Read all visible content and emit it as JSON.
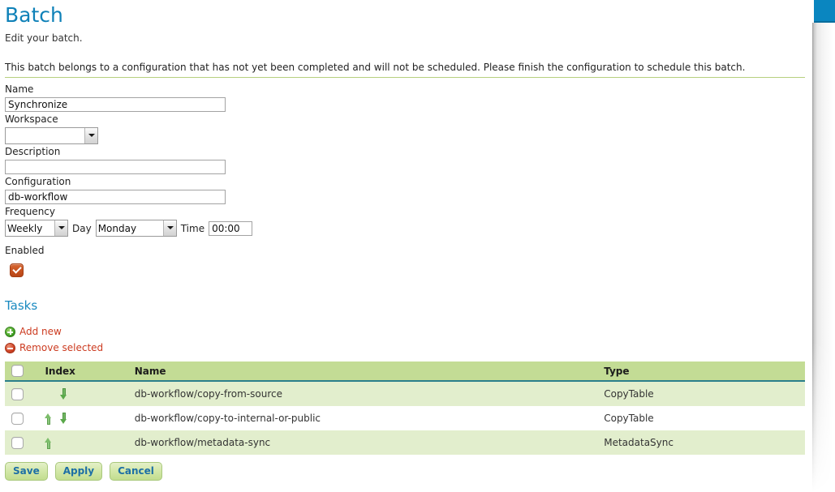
{
  "page": {
    "title": "Batch",
    "subtitle": "Edit your batch.",
    "feedback_message": "This batch belongs to a configuration that has not yet been completed and will not be scheduled. Please finish the configuration to schedule this batch.",
    "accent_color": "#0f81b8",
    "link_color": "#cc3b20",
    "table_header_color": "#c3dc95"
  },
  "form": {
    "name": {
      "label": "Name",
      "value": "Synchronize",
      "placeholder": ""
    },
    "workspace": {
      "label": "Workspace",
      "value": "",
      "options": [
        ""
      ]
    },
    "description": {
      "label": "Description",
      "value": "",
      "placeholder": ""
    },
    "configuration": {
      "label": "Configuration",
      "value": "db-workflow",
      "placeholder": ""
    },
    "frequency": {
      "label": "Frequency",
      "value": "Weekly",
      "options": [
        "Weekly"
      ],
      "day_label": "Day",
      "day_value": "Monday",
      "day_options": [
        "Monday"
      ],
      "time_label": "Time",
      "time_value": "00:00"
    },
    "enabled": {
      "label": "Enabled",
      "checked": true
    }
  },
  "tasks": {
    "title": "Tasks",
    "add_new_label": "Add new",
    "remove_selected_label": "Remove selected",
    "columns": [
      "",
      "Index",
      "Name",
      "Type"
    ],
    "rows": [
      {
        "selected": false,
        "move_up": false,
        "move_down": true,
        "name": "db-workflow/copy-from-source",
        "type": "CopyTable"
      },
      {
        "selected": false,
        "move_up": true,
        "move_down": true,
        "name": "db-workflow/copy-to-internal-or-public",
        "type": "CopyTable"
      },
      {
        "selected": false,
        "move_up": true,
        "move_down": false,
        "name": "db-workflow/metadata-sync",
        "type": "MetadataSync"
      }
    ]
  },
  "buttons": {
    "save": "Save",
    "apply": "Apply",
    "cancel": "Cancel"
  }
}
